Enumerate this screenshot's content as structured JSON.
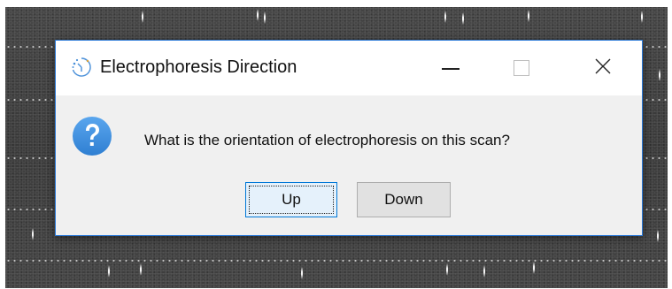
{
  "dialog": {
    "title": "Electrophoresis Direction",
    "message": "What is the orientation of electrophoresis on this scan?",
    "icons": {
      "app": "spinner-icon",
      "message": "question-icon",
      "minimize": "minimize-icon",
      "maximize": "maximize-icon",
      "close": "close-icon"
    },
    "buttons": {
      "up_label": "Up",
      "down_label": "Down"
    },
    "colors": {
      "accent": "#2b79d7",
      "question_icon": "#3b8fe0",
      "dialog_bg": "#f0f0f0"
    }
  }
}
